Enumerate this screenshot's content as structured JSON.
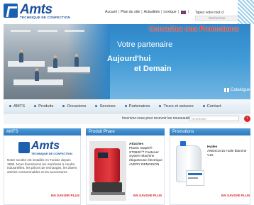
{
  "header": {
    "logo": {
      "name": "Amts",
      "subtitle": "TECHNIQUE DE CONFECTION"
    },
    "top_links": [
      "Accueil",
      "Plan du site",
      "Actualités",
      "Lexique"
    ],
    "search": {
      "value": "Tapez votre mot cl",
      "button": "Rechercher"
    }
  },
  "banner": {
    "promo": "Consultez nos Promotions",
    "line1": "Votre partenaire",
    "line2": "Aujourd'hui",
    "line3": "et Demain",
    "catalogue": "Catalogue"
  },
  "nav": {
    "items": [
      "AMTS",
      "Produits",
      "Occasions",
      "Services",
      "Partenaires",
      "Trucs et astuces",
      "Contact"
    ]
  },
  "newsletter": {
    "label": "Inscrivez-vous pour recevoir les nouveautés",
    "placeholder": "Newsletter"
  },
  "sections": {
    "amts": {
      "heading": "AMTS",
      "text": "Notre société est installée en Tunisie depuis 1986. Nous fournissons les machines à coudre industrielles, les pièces de rechanges, les divers articles consommables et les accessoires.",
      "more": "EN SAVOIR PLUS"
    },
    "product": {
      "heading": "Produit Phare",
      "title": "Attaches",
      "description": "Plastic Staple® ST9500™ Fastener System Machine étiqueteuse électrique AVERY DENNISON",
      "more": "EN SAVOIR PLUS"
    },
    "promotions": {
      "heading": "Promotions",
      "title": "Huiles",
      "description": "AMDS1V15 Huile blanche V15",
      "more": "EN SAVOIR PLUS"
    }
  },
  "colors": {
    "brand_blue": "#1b4f9a",
    "banner_blue": "#3f9ad6",
    "accent_red": "#e8412b",
    "link_red": "#d02424"
  }
}
